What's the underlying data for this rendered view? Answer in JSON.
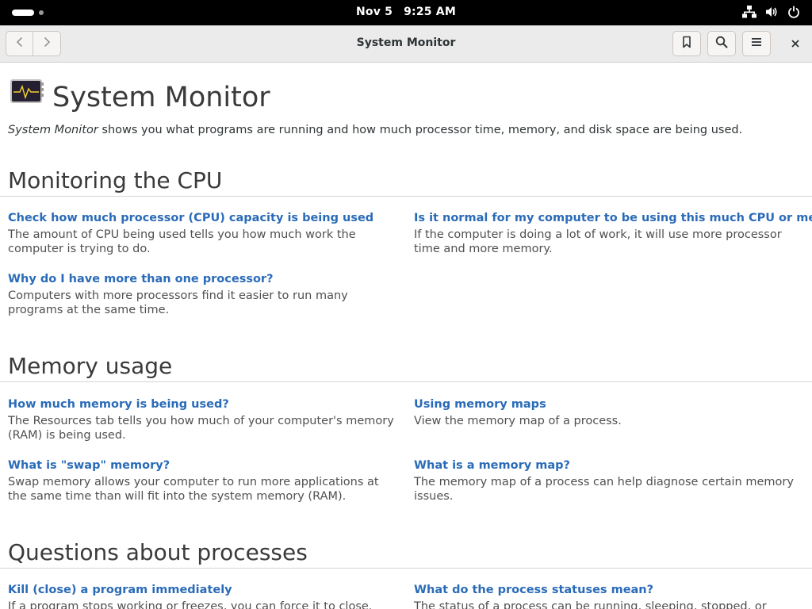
{
  "topbar": {
    "date": "Nov 5",
    "time": "9:25 AM",
    "icons": [
      "network-icon",
      "volume-icon",
      "power-icon"
    ]
  },
  "headerbar": {
    "title": "System Monitor",
    "icons": [
      "back-icon",
      "forward-icon",
      "bookmark-icon",
      "search-icon",
      "menu-icon",
      "close-icon"
    ]
  },
  "page": {
    "title": "System Monitor",
    "intro_emph": "System Monitor",
    "intro_rest": " shows you what programs are running and how much processor time, memory, and disk space are being used."
  },
  "sections": {
    "cpu": {
      "title": "Monitoring the CPU",
      "items": [
        {
          "title": "Check how much processor (CPU) capacity is being used",
          "desc": "The amount of CPU being used tells you how much work the computer is trying to do."
        },
        {
          "title": "Is it normal for my computer to be using this much CPU or memory?",
          "desc": "If the computer is doing a lot of work, it will use more processor time and more memory."
        },
        {
          "title": "Why do I have more than one processor?",
          "desc": "Computers with more processors find it easier to run many programs at the same time."
        }
      ]
    },
    "memory": {
      "title": "Memory usage",
      "items": [
        {
          "title": "How much memory is being used?",
          "desc": "The Resources tab tells you how much of your computer's memory (RAM) is being used."
        },
        {
          "title": "Using memory maps",
          "desc": "View the memory map of a process."
        },
        {
          "title": "What is \"swap\" memory?",
          "desc": "Swap memory allows your computer to run more applications at the same time than will fit into the system memory (RAM)."
        },
        {
          "title": "What is a memory map?",
          "desc": "The memory map of a process can help diagnose certain memory issues."
        }
      ]
    },
    "processes": {
      "title": "Questions about processes",
      "items": [
        {
          "title": "Kill (close) a program immediately",
          "desc": "If a program stops working or freezes, you can force it to close."
        },
        {
          "title": "What do the process statuses mean?",
          "desc": "The status of a process can be running, sleeping, stopped, or zombie."
        }
      ]
    }
  },
  "colors": {
    "link": "#2a6bb8",
    "topbar": "#000000",
    "headerbar": "#ebebeb"
  }
}
